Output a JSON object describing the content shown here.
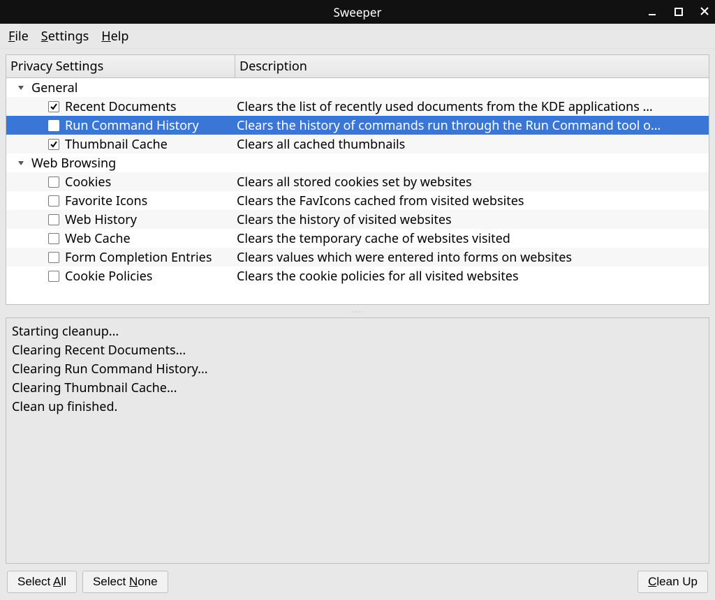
{
  "window": {
    "title": "Sweeper"
  },
  "menubar": {
    "file": "File",
    "settings": "Settings",
    "help": "Help"
  },
  "columns": {
    "c1": "Privacy Settings",
    "c2": "Description"
  },
  "groups": [
    {
      "label": "General",
      "items": [
        {
          "label": "Recent Documents",
          "checked": true,
          "desc": "Clears the list of recently used documents from the KDE applications …",
          "selected": false
        },
        {
          "label": "Run Command History",
          "checked": true,
          "desc": "Clears the history of commands run through the Run Command tool o…",
          "selected": true
        },
        {
          "label": "Thumbnail Cache",
          "checked": true,
          "desc": "Clears all cached thumbnails",
          "selected": false
        }
      ]
    },
    {
      "label": "Web Browsing",
      "items": [
        {
          "label": "Cookies",
          "checked": false,
          "desc": "Clears all stored cookies set by websites",
          "selected": false
        },
        {
          "label": "Favorite Icons",
          "checked": false,
          "desc": "Clears the FavIcons cached from visited websites",
          "selected": false
        },
        {
          "label": "Web History",
          "checked": false,
          "desc": "Clears the history of visited websites",
          "selected": false
        },
        {
          "label": "Web Cache",
          "checked": false,
          "desc": "Clears the temporary cache of websites visited",
          "selected": false
        },
        {
          "label": "Form Completion Entries",
          "checked": false,
          "desc": "Clears values which were entered into forms on websites",
          "selected": false
        },
        {
          "label": "Cookie Policies",
          "checked": false,
          "desc": "Clears the cookie policies for all visited websites",
          "selected": false
        }
      ]
    }
  ],
  "log": "Starting cleanup...\nClearing Recent Documents...\nClearing Run Command History...\nClearing Thumbnail Cache...\nClean up finished.",
  "buttons": {
    "select_all": "Select All",
    "select_none": "Select None",
    "clean_up": "Clean Up"
  }
}
